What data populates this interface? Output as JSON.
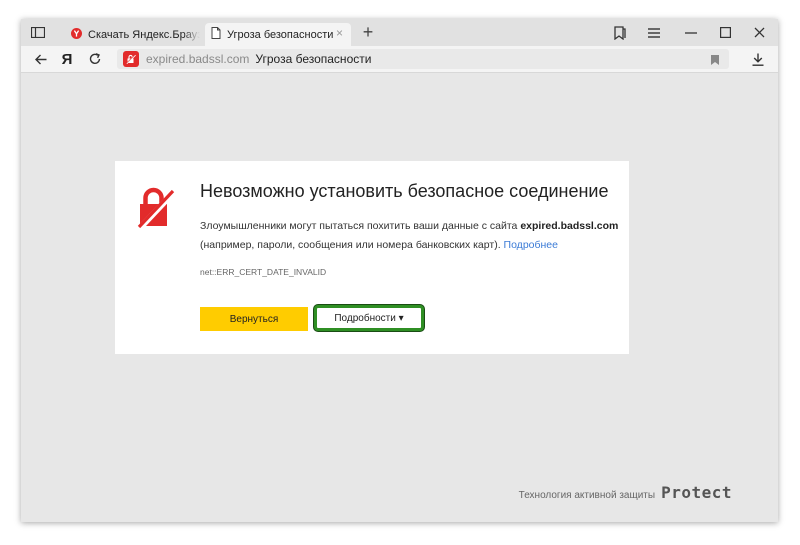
{
  "tabs": [
    {
      "title": "Скачать Яндекс.Браузер д",
      "favicon": "yandex-favicon-icon",
      "active": false
    },
    {
      "title": "Угроза безопасности",
      "favicon": "page-icon",
      "active": true
    }
  ],
  "tab_close_symbol": "×",
  "new_tab_symbol": "+",
  "nav": {
    "yandex_button": "Я"
  },
  "address": {
    "domain": "expired.badssl.com",
    "page_title": "Угроза безопасности"
  },
  "error_page": {
    "heading": "Невозможно установить безопасное соединение",
    "message_prefix": "Злоумышленники могут пытаться похитить ваши данные с сайта ",
    "message_domain": "expired.badssl.com",
    "message_suffix": "(например, пароли, сообщения или номера банковских карт). ",
    "more_link": "Подробнее",
    "error_code": "net::ERR_CERT_DATE_INVALID",
    "back_button": "Вернуться",
    "details_button": "Подробности ▾"
  },
  "footer": {
    "description": "Технология активной защиты",
    "logo": "Protect"
  },
  "colors": {
    "accent_red": "#e22b2b",
    "button_yellow": "#ffcc00",
    "link_blue": "#3b7bd6",
    "highlight_green": "#2f8f24"
  }
}
